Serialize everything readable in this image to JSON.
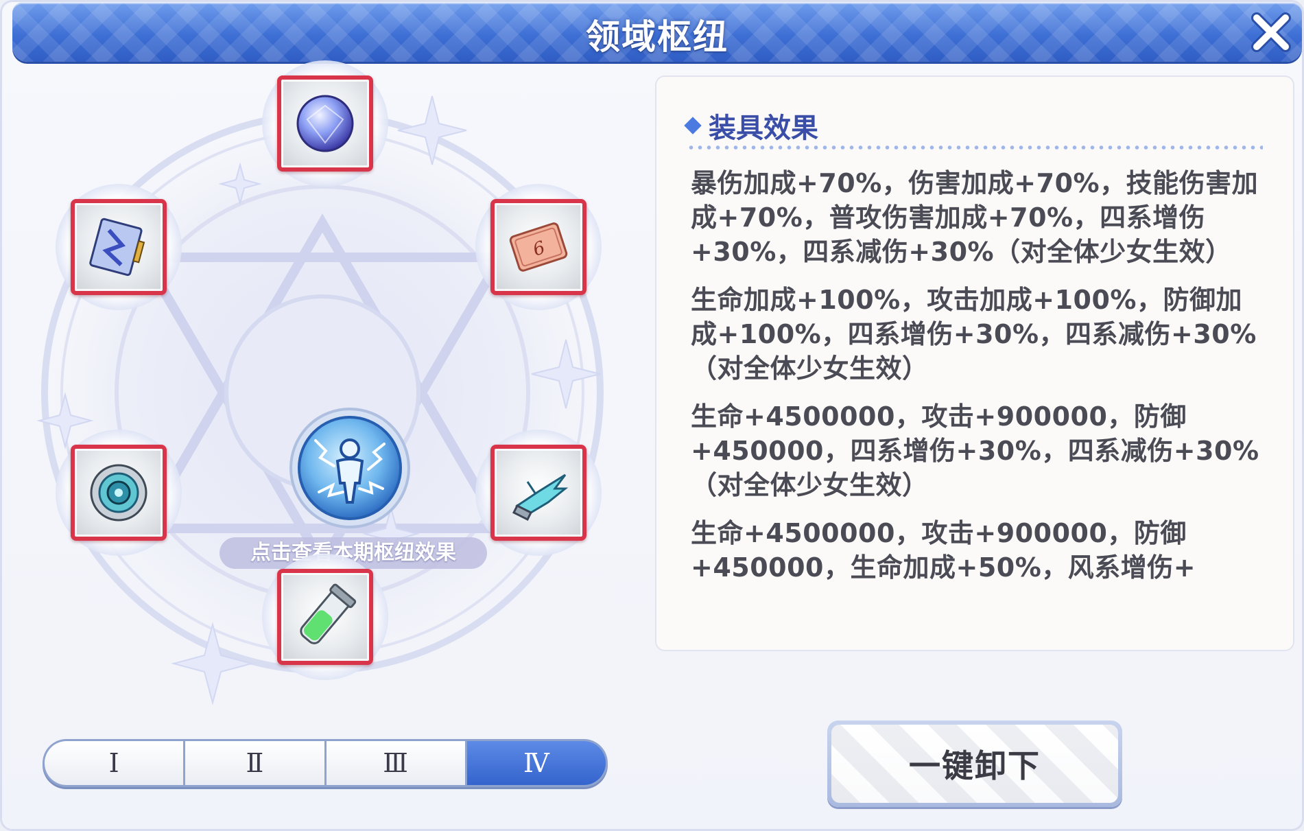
{
  "window": {
    "title": "领域枢纽"
  },
  "center": {
    "label": "点击查看本期枢纽效果"
  },
  "slots": [
    {
      "name": "crystal-orb-icon"
    },
    {
      "name": "card-6-icon"
    },
    {
      "name": "wing-armor-icon"
    },
    {
      "name": "green-vial-icon"
    },
    {
      "name": "mech-core-icon"
    },
    {
      "name": "blueprint-icon"
    }
  ],
  "tiers": [
    {
      "label": "Ⅰ"
    },
    {
      "label": "Ⅱ"
    },
    {
      "label": "Ⅲ"
    },
    {
      "label": "Ⅳ"
    }
  ],
  "active_tier": "Ⅳ",
  "effects": {
    "title": "装具效果",
    "items": [
      "暴伤加成+70%，伤害加成+70%，技能伤害加成+70%，普攻伤害加成+70%，四系增伤+30%，四系减伤+30%（对全体少女生效）",
      "生命加成+100%，攻击加成+100%，防御加成+100%，四系增伤+30%，四系减伤+30%（对全体少女生效）",
      "生命+4500000，攻击+900000，防御+450000，四系增伤+30%，四系减伤+30%（对全体少女生效）",
      "生命+4500000，攻击+900000，防御+450000，生命加成+50%，风系增伤+"
    ]
  },
  "buttons": {
    "unequip": "一键卸下"
  },
  "colors": {
    "accent": "#3e6fd4",
    "slot_border": "#d8344a",
    "text": "#4b4b55"
  }
}
